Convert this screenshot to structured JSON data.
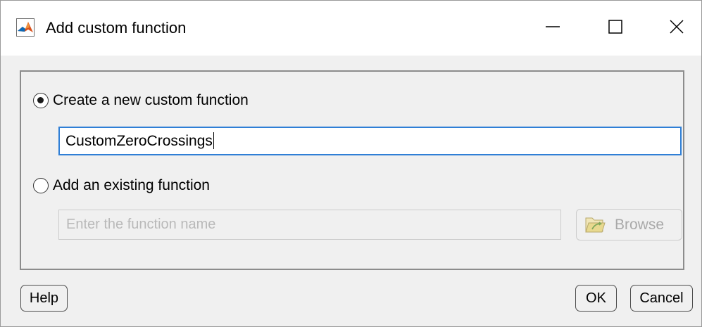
{
  "window": {
    "title": "Add custom function",
    "app_icon": "matlab-logo-icon",
    "controls": {
      "minimize_icon": "minimize-icon",
      "maximize_icon": "maximize-icon",
      "close_icon": "close-icon"
    }
  },
  "options": {
    "create_new": {
      "label": "Create a new custom function",
      "selected": true,
      "input_value": "CustomZeroCrossings"
    },
    "add_existing": {
      "label": "Add an existing function",
      "selected": false,
      "input_placeholder": "Enter the function name",
      "browse_label": "Browse",
      "browse_icon": "folder-open-icon"
    }
  },
  "buttons": {
    "help_label": "Help",
    "ok_label": "OK",
    "cancel_label": "Cancel"
  },
  "colors": {
    "focus_border": "#2f7fd6",
    "dialog_background": "#f0f0f0",
    "disabled_text": "#b9b9b9"
  }
}
